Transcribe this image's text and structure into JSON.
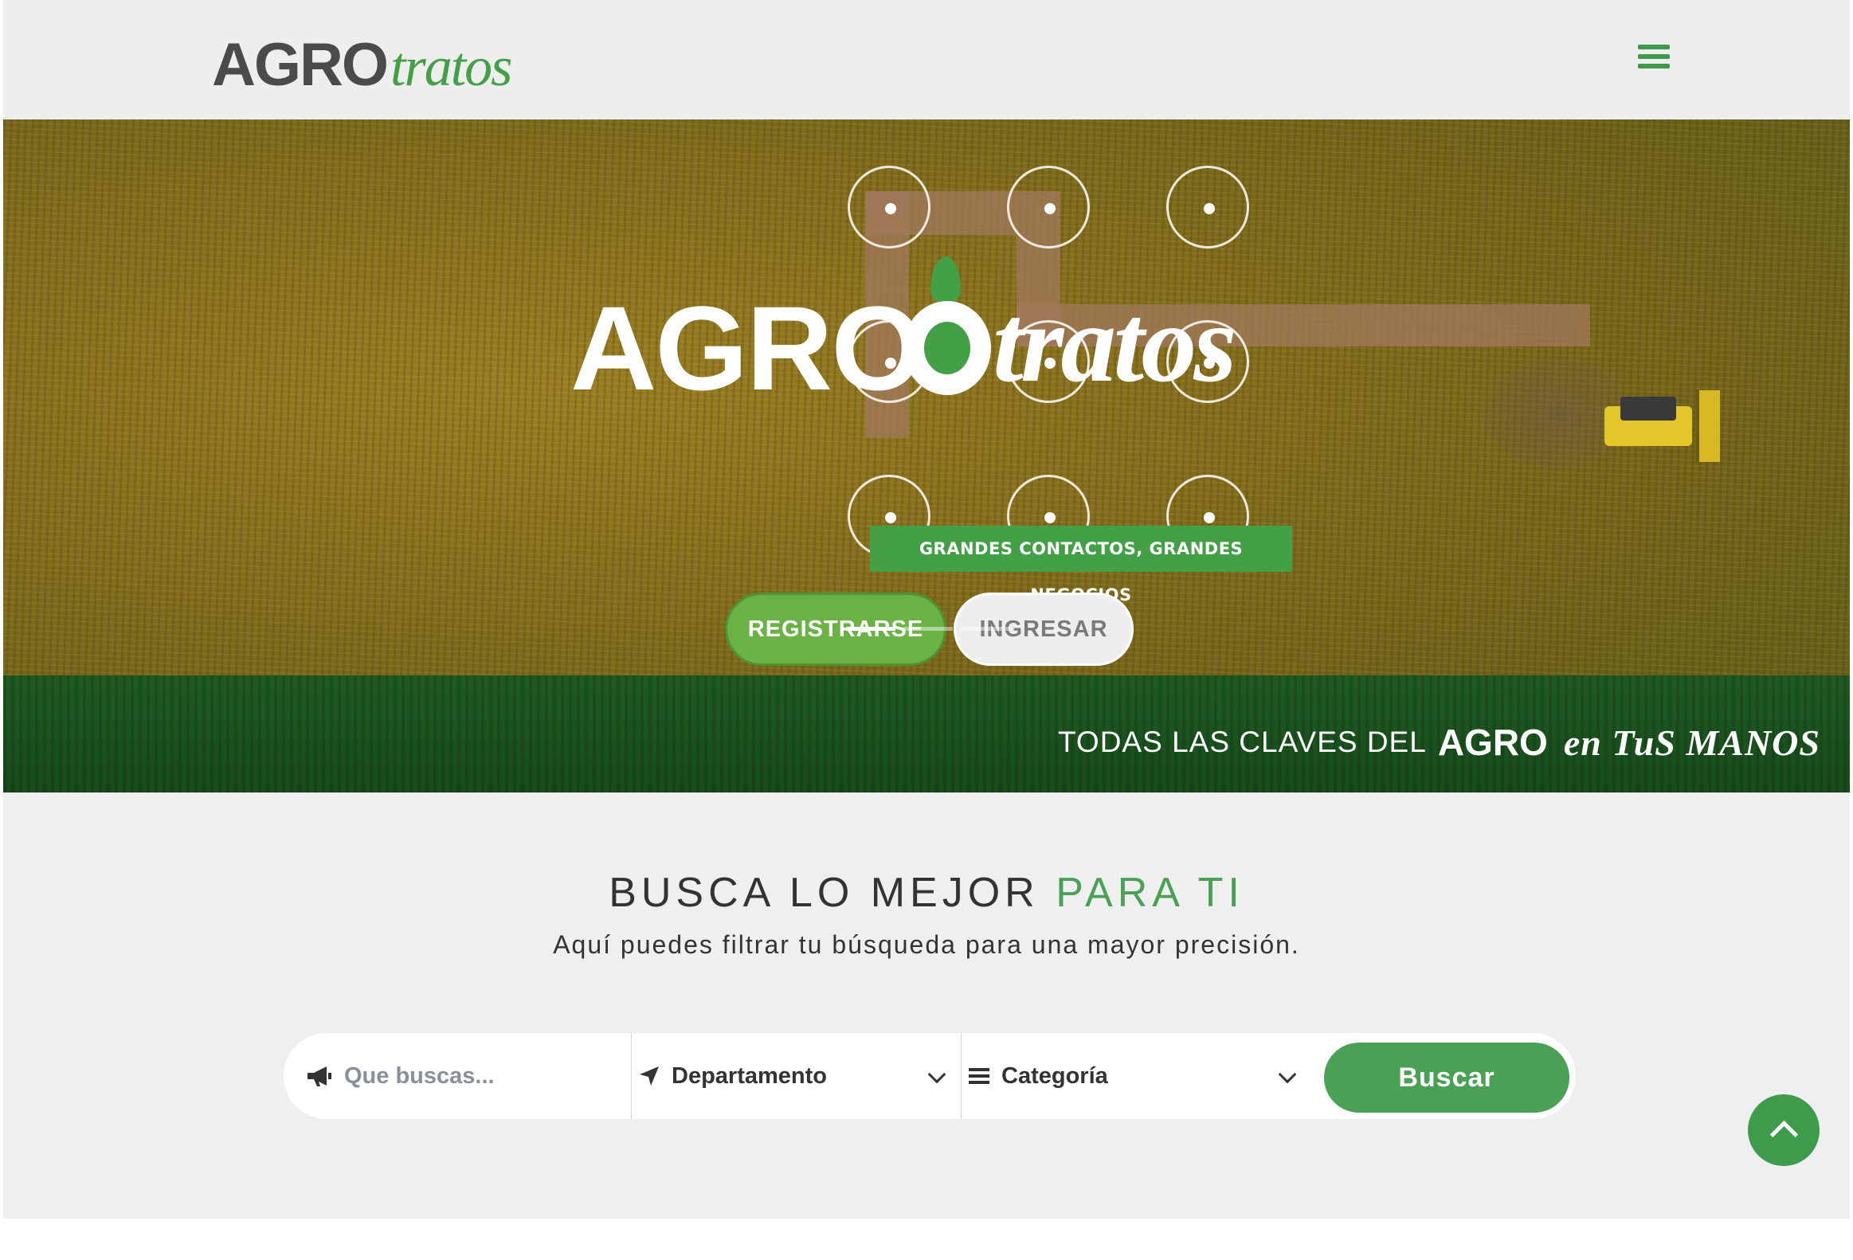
{
  "header": {
    "logo": {
      "agro": "AGRO",
      "tratos": "tratos"
    },
    "menu_icon": "hamburger-menu-icon"
  },
  "hero": {
    "logo": {
      "agro": "AGRO",
      "tratos": "tratos"
    },
    "tagline": "GRANDES CONTACTOS, GRANDES NEGOCIOS",
    "register_label": "REGISTRARSE",
    "login_label": "INGRESAR",
    "slides": {
      "count": 3,
      "active": 1
    },
    "slogan": {
      "prefix": "TODAS LAS CLAVES DEL",
      "brand": "AGRO",
      "suffix": "en TuS MANOS"
    }
  },
  "search": {
    "title_main": "BUSCA LO MEJOR",
    "title_accent": "PARA TI",
    "subtitle": "Aquí puedes filtrar tu búsqueda para una mayor precisión.",
    "query_placeholder": "Que buscas...",
    "department_label": "Departamento",
    "category_label": "Categoría",
    "button_label": "Buscar"
  },
  "colors": {
    "brand_green": "#43a047",
    "button_green": "#4aa155",
    "dark_text": "#333333"
  }
}
